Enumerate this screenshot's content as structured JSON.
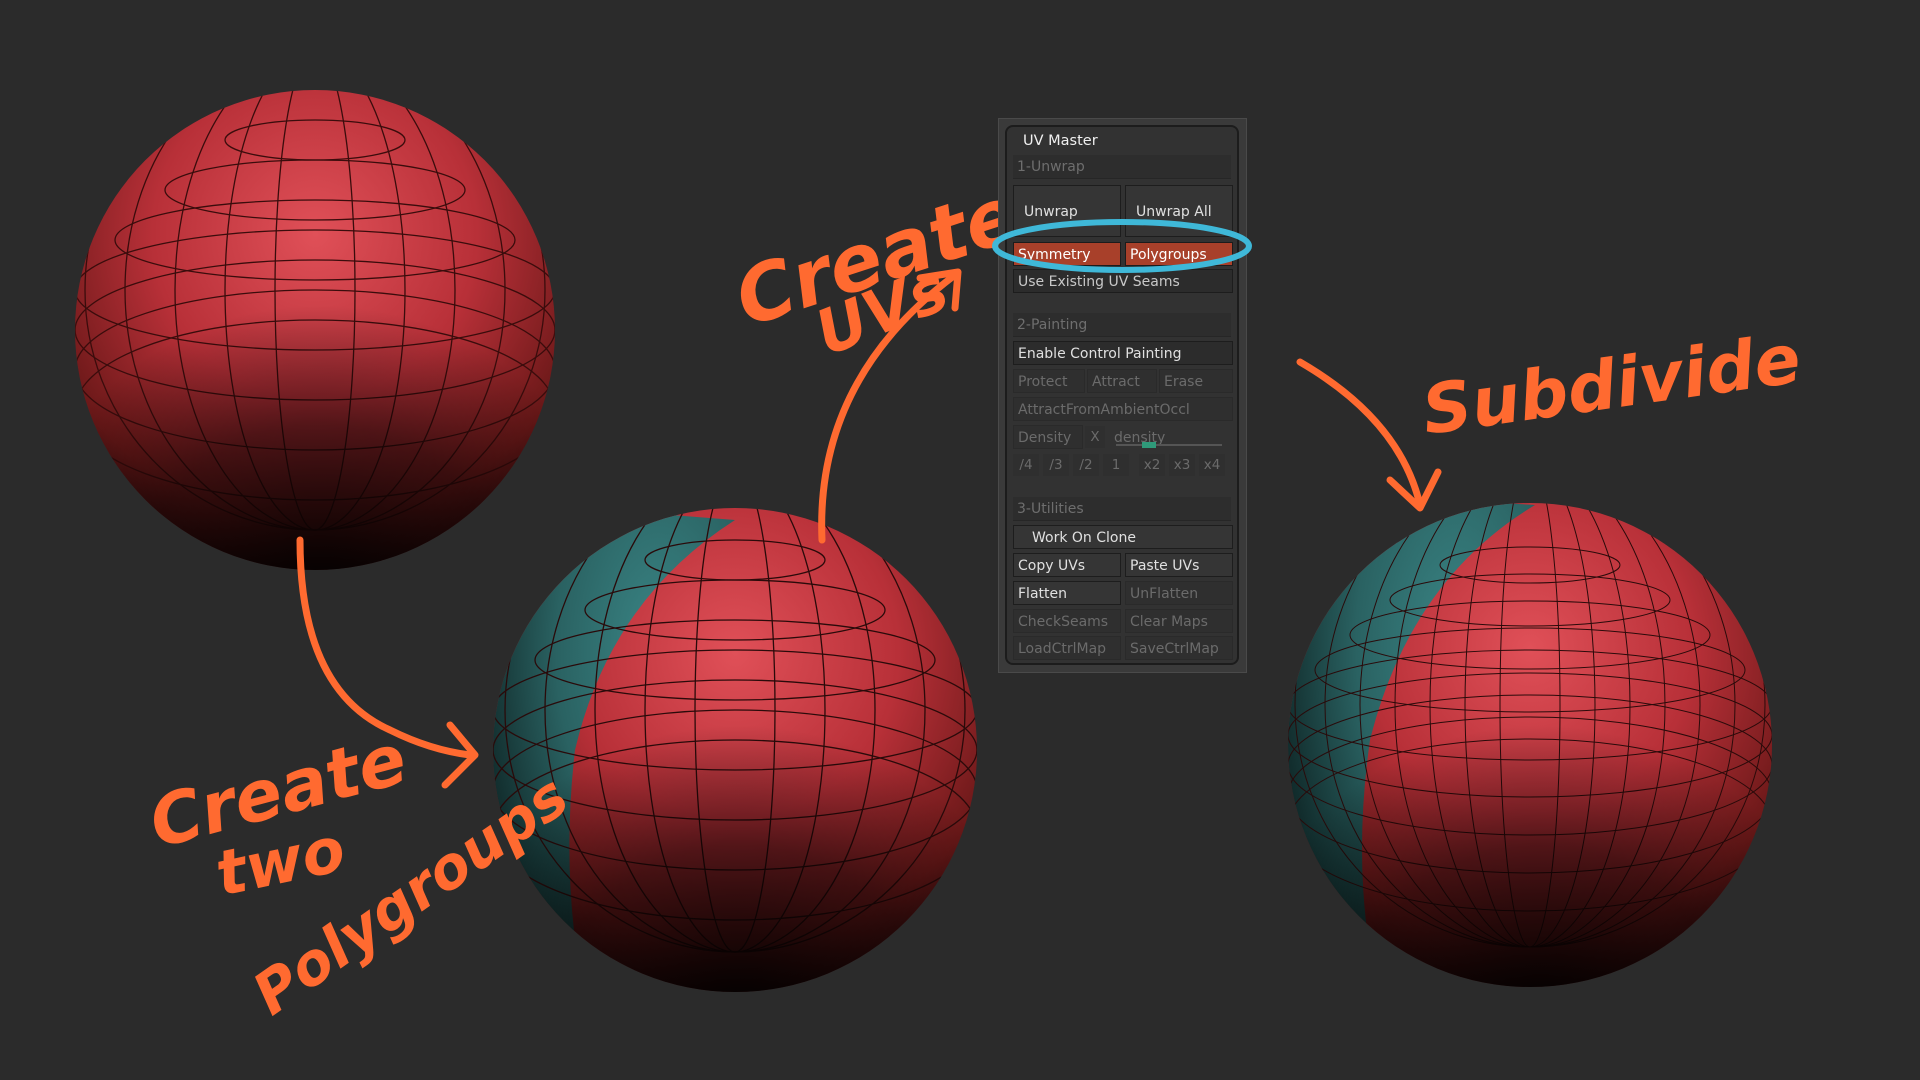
{
  "annotations": {
    "create_polygroups": [
      "Create",
      "two",
      "Polygroups"
    ],
    "create_uvs": [
      "Create",
      "UVs"
    ],
    "subdivide": "Subdivide"
  },
  "colors": {
    "background": "#2b2b2b",
    "mesh_red": "#c23a40",
    "mesh_teal": "#2e6e6e",
    "annotation_orange": "#ff6a30",
    "highlight_circle": "#3fb8d8",
    "active_button": "#a8402a"
  },
  "uv_master": {
    "title": "UV Master",
    "section1": "1-Unwrap",
    "unwrap": "Unwrap",
    "unwrap_all": "Unwrap All",
    "symmetry": "Symmetry",
    "polygroups": "Polygroups",
    "use_existing": "Use Existing UV Seams",
    "section2": "2-Painting",
    "enable_control_painting": "Enable Control Painting",
    "protect": "Protect",
    "attract": "Attract",
    "erase": "Erase",
    "attract_ambient": "AttractFromAmbientOccl",
    "density": "Density",
    "x": "X",
    "density_slider": "density",
    "density_steps": [
      "/4",
      "/3",
      "/2",
      "1",
      "x2",
      "x3",
      "x4"
    ],
    "section3": "3-Utilities",
    "work_on_clone": "Work On Clone",
    "copy_uvs": "Copy UVs",
    "paste_uvs": "Paste UVs",
    "flatten": "Flatten",
    "unflatten": "UnFlatten",
    "check_seams": "CheckSeams",
    "clear_maps": "Clear Maps",
    "load_ctrl_map": "LoadCtrlMap",
    "save_ctrl_map": "SaveCtrlMap"
  }
}
